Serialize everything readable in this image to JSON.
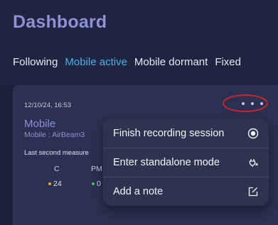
{
  "header": {
    "title": "Dashboard",
    "tabs": [
      "Following",
      "Mobile active",
      "Mobile dormant",
      "Fixed"
    ],
    "active_tab": "Mobile active"
  },
  "session": {
    "timestamp": "12/10/24, 16:53",
    "name": "Mobile",
    "type": "Mobile : AirBeam3",
    "last_measure": "Last second measure",
    "columns": [
      {
        "label": "C",
        "value": "24",
        "dot_color": "#f5a623"
      },
      {
        "label": "PM",
        "value": "0",
        "dot_color": "#4cc36a"
      }
    ]
  },
  "menu": {
    "items": [
      {
        "label": "Finish recording session",
        "icon": "stop-circle-icon"
      },
      {
        "label": "Enter standalone mode",
        "icon": "standalone-mode-icon"
      },
      {
        "label": "Add a note",
        "icon": "note-edit-icon"
      }
    ]
  },
  "colors": {
    "background": "#1b2036",
    "card": "#2b3152",
    "accent": "#3fb5e8",
    "title": "#8c92d4",
    "annotation": "#d4222a"
  }
}
